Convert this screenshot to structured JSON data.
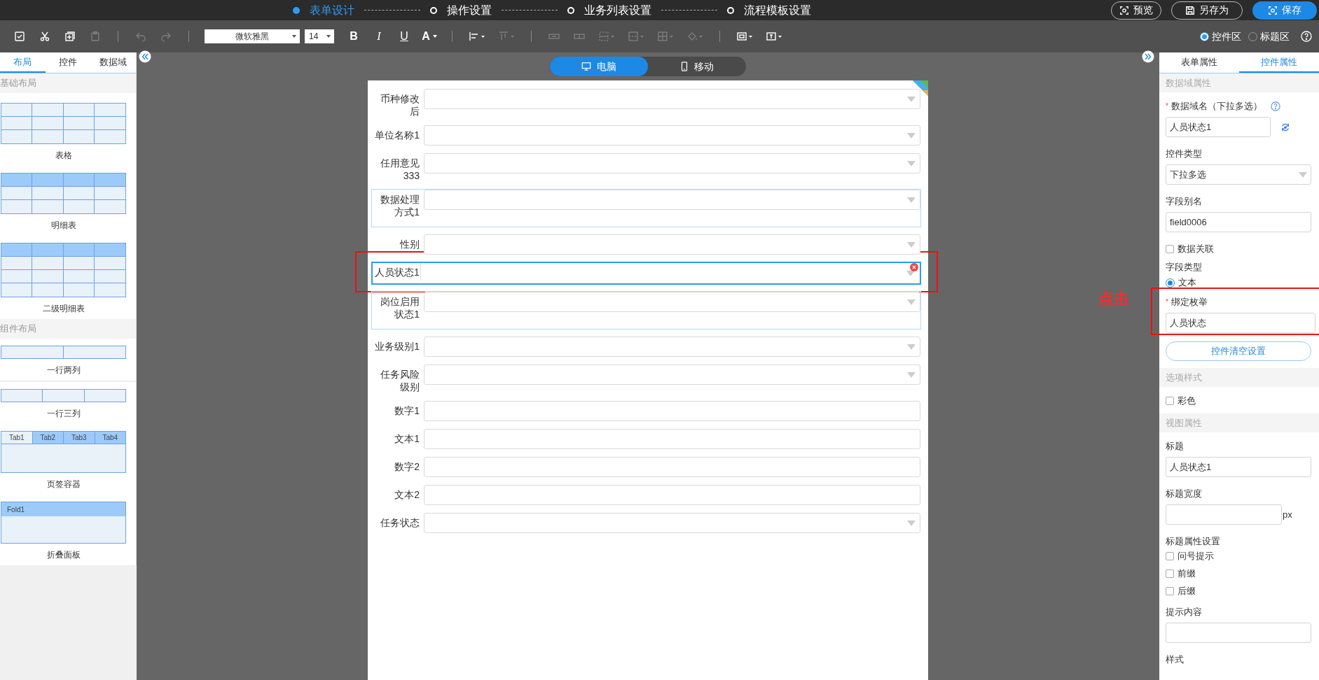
{
  "steps": [
    {
      "label": "表单设计",
      "selected": true
    },
    {
      "label": "操作设置",
      "selected": false
    },
    {
      "label": "业务列表设置",
      "selected": false
    },
    {
      "label": "流程模板设置",
      "selected": false
    }
  ],
  "header_buttons": [
    {
      "label": "预览",
      "kind": "preview"
    },
    {
      "label": "另存为",
      "kind": "save-as"
    },
    {
      "label": "保存",
      "kind": "save"
    }
  ],
  "toolbar": [
    {
      "kind": "select-all",
      "disabled": false
    },
    {
      "kind": "cut",
      "disabled": false
    },
    {
      "kind": "copy",
      "disabled": false
    },
    {
      "kind": "paste",
      "disabled": true
    },
    {
      "kind": "separator"
    },
    {
      "kind": "undo",
      "disabled": true
    },
    {
      "kind": "redo",
      "disabled": true
    },
    {
      "kind": "separator"
    },
    {
      "kind": "font",
      "value": "微软雅黑"
    },
    {
      "kind": "size",
      "value": "14"
    },
    {
      "kind": "bold",
      "label": "B",
      "disabled": false
    },
    {
      "kind": "italic",
      "label": "I",
      "disabled": false
    },
    {
      "kind": "underline",
      "label": "U",
      "disabled": false
    },
    {
      "kind": "color",
      "label": "A",
      "disabled": false
    },
    {
      "kind": "separator"
    },
    {
      "kind": "align",
      "disabled": false
    },
    {
      "kind": "valign",
      "disabled": true
    },
    {
      "kind": "separator"
    },
    {
      "kind": "merge",
      "disabled": true
    },
    {
      "kind": "split",
      "disabled": true
    },
    {
      "kind": "border",
      "disabled": true
    },
    {
      "kind": "border-style",
      "disabled": true
    },
    {
      "kind": "cells",
      "disabled": true
    },
    {
      "kind": "fill",
      "disabled": true
    },
    {
      "kind": "separator"
    },
    {
      "kind": "frame",
      "disabled": false
    },
    {
      "kind": "textbox",
      "disabled": false
    }
  ],
  "area_options": [
    {
      "label": "控件区",
      "selected": true
    },
    {
      "label": "标题区",
      "selected": false
    }
  ],
  "left_tabs": [
    {
      "label": "布局",
      "selected": true
    },
    {
      "label": "控件",
      "selected": false
    },
    {
      "label": "数据域",
      "selected": false
    }
  ],
  "left_sections": [
    {
      "title": "基础布局",
      "items": [
        {
          "kind": "table",
          "label": "表格"
        },
        {
          "kind": "detail",
          "label": "明细表"
        },
        {
          "kind": "detail2",
          "label": "二级明细表"
        }
      ]
    },
    {
      "title": "组件布局",
      "items": [
        {
          "kind": "cols2",
          "label": "一行两列"
        },
        {
          "kind": "cols3",
          "label": "一行三列"
        },
        {
          "kind": "tabs",
          "label": "页签容器",
          "tabs": [
            {
              "label": "Tab1",
              "selected": true
            },
            {
              "label": "Tab2",
              "selected": false
            },
            {
              "label": "Tab3",
              "selected": false
            },
            {
              "label": "Tab4",
              "selected": false
            }
          ]
        },
        {
          "kind": "fold",
          "label": "折叠面板",
          "header": "Fold1"
        }
      ]
    }
  ],
  "device_tabs": [
    {
      "label": "电脑",
      "kind": "desktop",
      "selected": true
    },
    {
      "label": "移动",
      "kind": "mobile",
      "selected": false
    }
  ],
  "form_rows": [
    {
      "label": "币种修改后",
      "kind": "select",
      "selected": false,
      "grouped": false,
      "annotated": false
    },
    {
      "label": "单位名称1",
      "kind": "select",
      "selected": false,
      "grouped": false,
      "annotated": false
    },
    {
      "label": "任用意见333",
      "kind": "select",
      "selected": false,
      "grouped": false,
      "annotated": false
    },
    {
      "label": "数据处理方式1",
      "kind": "select",
      "selected": false,
      "grouped": true,
      "annotated": false
    },
    {
      "label": "性别",
      "kind": "select",
      "selected": false,
      "grouped": false,
      "annotated": false
    },
    {
      "label": "人员状态1",
      "kind": "select",
      "selected": true,
      "grouped": false,
      "annotated": true
    },
    {
      "label": "岗位启用状态1",
      "kind": "select",
      "selected": false,
      "grouped": true,
      "annotated": false
    },
    {
      "label": "业务级别1",
      "kind": "select",
      "selected": false,
      "grouped": false,
      "annotated": false
    },
    {
      "label": "任务风险级别",
      "kind": "select",
      "selected": false,
      "grouped": false,
      "annotated": false
    },
    {
      "label": "数字1",
      "kind": "input",
      "selected": false,
      "grouped": false,
      "annotated": false
    },
    {
      "label": "文本1",
      "kind": "input",
      "selected": false,
      "grouped": false,
      "annotated": false
    },
    {
      "label": "数字2",
      "kind": "input",
      "selected": false,
      "grouped": false,
      "annotated": false
    },
    {
      "label": "文本2",
      "kind": "input",
      "selected": false,
      "grouped": false,
      "annotated": false
    },
    {
      "label": "任务状态",
      "kind": "select",
      "selected": false,
      "grouped": false,
      "annotated": false
    }
  ],
  "annotation_note": "点击",
  "right_tabs": [
    {
      "label": "表单属性",
      "selected": false
    },
    {
      "label": "控件属性",
      "selected": true
    }
  ],
  "properties": [
    {
      "kind": "section",
      "label": "数据域属性"
    },
    {
      "kind": "domain-input",
      "label": "数据域名（下拉多选）",
      "required_mark": "*",
      "value": "人员状态1",
      "annotated": false
    },
    {
      "kind": "select",
      "label": "控件类型",
      "value": "下拉多选",
      "annotated": false
    },
    {
      "kind": "input",
      "label": "字段别名",
      "value": "field0006",
      "annotated": false
    },
    {
      "kind": "checkbox",
      "label": "数据关联",
      "checked": false
    },
    {
      "kind": "radio-group",
      "label": "字段类型",
      "options": [
        {
          "label": "文本",
          "selected": true
        }
      ]
    },
    {
      "kind": "input",
      "label": "绑定枚举",
      "required_mark": "*",
      "value": "人员状态",
      "annotated": true
    },
    {
      "kind": "button",
      "label": "控件清空设置"
    },
    {
      "kind": "section",
      "label": "选项样式"
    },
    {
      "kind": "checkbox",
      "label": "彩色",
      "checked": false
    },
    {
      "kind": "section",
      "label": "视图属性"
    },
    {
      "kind": "input",
      "label": "标题",
      "value": "人员状态1",
      "annotated": false
    },
    {
      "kind": "unit-input",
      "label": "标题宽度",
      "unit": "px",
      "annotated": false
    },
    {
      "kind": "checkbox-group",
      "label": "标题属性设置",
      "options": [
        {
          "label": "问号提示",
          "checked": false
        },
        {
          "label": "前缀",
          "checked": false
        },
        {
          "label": "后缀",
          "checked": false
        }
      ]
    },
    {
      "kind": "input",
      "label": "提示内容",
      "annotated": false
    },
    {
      "kind": "label",
      "label": "样式"
    }
  ]
}
